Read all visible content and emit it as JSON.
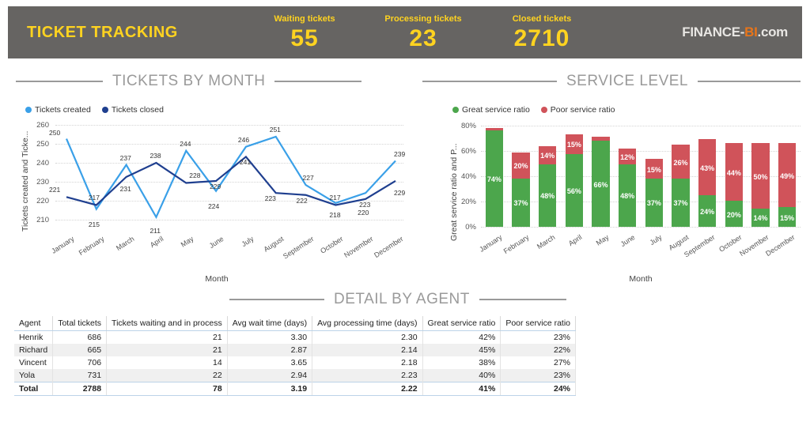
{
  "header": {
    "title": "TICKET TRACKING",
    "kpis": [
      {
        "label": "Waiting tickets",
        "value": "55"
      },
      {
        "label": "Processing tickets",
        "value": "23"
      },
      {
        "label": "Closed tickets",
        "value": "2710"
      }
    ],
    "logo": {
      "part1": "FINANCE-",
      "part2": "BI",
      "part3": ".com"
    },
    "bg_color": "#666462",
    "accent_color": "#FFD320"
  },
  "sections": {
    "tickets_by_month": "TICKETS BY MONTH",
    "service_level": "SERVICE LEVEL",
    "detail_by_agent": "DETAIL BY AGENT"
  },
  "chart_data": [
    {
      "type": "line",
      "title": "TICKETS BY MONTH",
      "xlabel": "Month",
      "ylabel": "Tickets created and Ticke...",
      "ylim": [
        205,
        262
      ],
      "yticks": [
        210,
        220,
        230,
        240,
        250,
        260
      ],
      "grid": true,
      "legend_position": "top-left",
      "categories": [
        "January",
        "February",
        "March",
        "April",
        "May",
        "June",
        "July",
        "August",
        "September",
        "October",
        "November",
        "December"
      ],
      "series": [
        {
          "name": "Tickets created",
          "color": "#3AA0E8",
          "values": [
            250,
            215,
            237,
            211,
            244,
            224,
            246,
            251,
            227,
            218,
            223,
            239
          ]
        },
        {
          "name": "Tickets closed",
          "color": "#1F3F8F",
          "values": [
            221,
            217,
            231,
            238,
            228,
            229,
            241,
            223,
            222,
            217,
            220,
            229
          ]
        }
      ]
    },
    {
      "type": "bar",
      "stacked": true,
      "title": "SERVICE LEVEL",
      "xlabel": "Month",
      "ylabel": "Great service ratio and P...",
      "ylim": [
        0,
        80
      ],
      "yticks": [
        "0%",
        "20%",
        "40%",
        "60%",
        "80%"
      ],
      "grid": true,
      "legend_position": "top-left",
      "categories": [
        "January",
        "February",
        "March",
        "April",
        "May",
        "June",
        "July",
        "August",
        "September",
        "October",
        "November",
        "December"
      ],
      "series": [
        {
          "name": "Great service ratio",
          "color": "#4CA64C",
          "values": [
            74,
            37,
            48,
            56,
            66,
            48,
            37,
            37,
            24,
            20,
            14,
            15
          ]
        },
        {
          "name": "Poor service ratio",
          "color": "#D0535A",
          "values": [
            2,
            20,
            14,
            15,
            3,
            12,
            15,
            26,
            43,
            44,
            50,
            49
          ]
        }
      ],
      "value_labels": {
        "great": [
          "74%",
          "37%",
          "48%",
          "56%",
          "66%",
          "48%",
          "37%",
          "37%",
          "24%",
          "20%",
          "14%",
          "15%"
        ],
        "poor": [
          "",
          "20%",
          "14%",
          "15%",
          "",
          "12%",
          "15%",
          "26%",
          "43%",
          "44%",
          "50%",
          "49%"
        ]
      }
    }
  ],
  "table": {
    "columns": [
      {
        "label": "Agent",
        "align": "left"
      },
      {
        "label": "Total tickets",
        "align": "right"
      },
      {
        "label": "Tickets waiting and in process",
        "align": "right"
      },
      {
        "label": "Avg wait time (days)",
        "align": "right"
      },
      {
        "label": "Avg processing time (days)",
        "align": "right"
      },
      {
        "label": "Great service ratio",
        "align": "right"
      },
      {
        "label": "Poor service ratio",
        "align": "right"
      }
    ],
    "rows": [
      [
        "Henrik",
        "686",
        "21",
        "3.30",
        "2.30",
        "42%",
        "23%"
      ],
      [
        "Richard",
        "665",
        "21",
        "2.87",
        "2.14",
        "45%",
        "22%"
      ],
      [
        "Vincent",
        "706",
        "14",
        "3.65",
        "2.18",
        "38%",
        "27%"
      ],
      [
        "Yola",
        "731",
        "22",
        "2.94",
        "2.23",
        "40%",
        "23%"
      ]
    ],
    "total_row": [
      "Total",
      "2788",
      "78",
      "3.19",
      "2.22",
      "41%",
      "24%"
    ]
  }
}
